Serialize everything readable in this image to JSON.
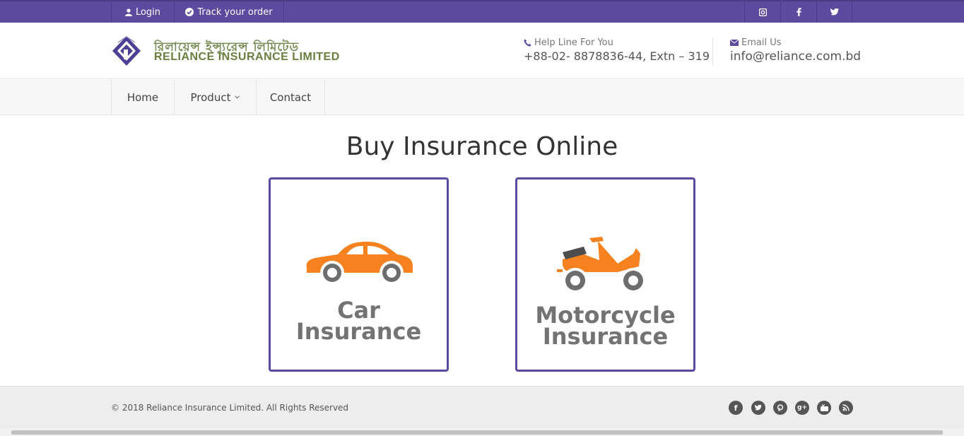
{
  "topbar": {
    "login_label": "Login",
    "track_label": "Track your order",
    "social": [
      "instagram-icon",
      "facebook-icon",
      "twitter-icon"
    ],
    "color": "#5b4a9e"
  },
  "header": {
    "logo_bn": "রিলায়েন্স ইন্স্যুরেন্স লিমিটেড",
    "logo_en": "RELIANCE INSURANCE LIMITED",
    "help_label": "Help Line For You",
    "help_value": "+88-02- 8878836-44, Extn – 319",
    "email_label": "Email Us",
    "email_value": "info@reliance.com.bd"
  },
  "nav": {
    "home": "Home",
    "product": "Product",
    "contact": "Contact"
  },
  "main": {
    "title": "Buy Insurance Online",
    "cards": [
      {
        "line1": "Car",
        "line2": "Insurance",
        "icon": "car-icon"
      },
      {
        "line1": "Motorcycle",
        "line2": "Insurance",
        "icon": "motorcycle-icon"
      }
    ]
  },
  "footer": {
    "copyright": "© 2018 Reliance Insurance Limited. All Rights Reserved",
    "social": [
      "facebook-icon",
      "twitter-icon",
      "pinterest-icon",
      "google-plus-icon",
      "youtube-icon",
      "rss-icon"
    ]
  }
}
